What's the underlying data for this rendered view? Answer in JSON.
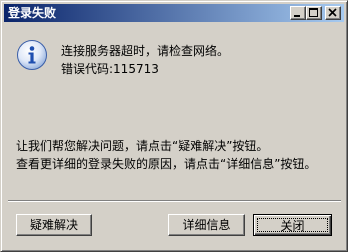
{
  "window": {
    "title": "登录失败",
    "controls": {
      "minimize": "minimize-icon",
      "maximize": "maximize-icon",
      "close": "close-icon"
    }
  },
  "message": {
    "icon": "info-icon",
    "line1": "连接服务器超时，请检查网络。",
    "line2": "错误代码:115713",
    "help_line1": "让我们帮您解决问题，请点击“疑难解决”按钮。",
    "help_line2": "查看更详细的登录失败的原因，请点击“详细信息”按钮。"
  },
  "buttons": {
    "troubleshoot": "疑难解决",
    "details": "详细信息",
    "close": "关闭"
  },
  "colors": {
    "titlebar_start": "#0a246a",
    "titlebar_end": "#a6caf0",
    "face": "#d4d0c8",
    "info_blue": "#1f4fb0"
  }
}
